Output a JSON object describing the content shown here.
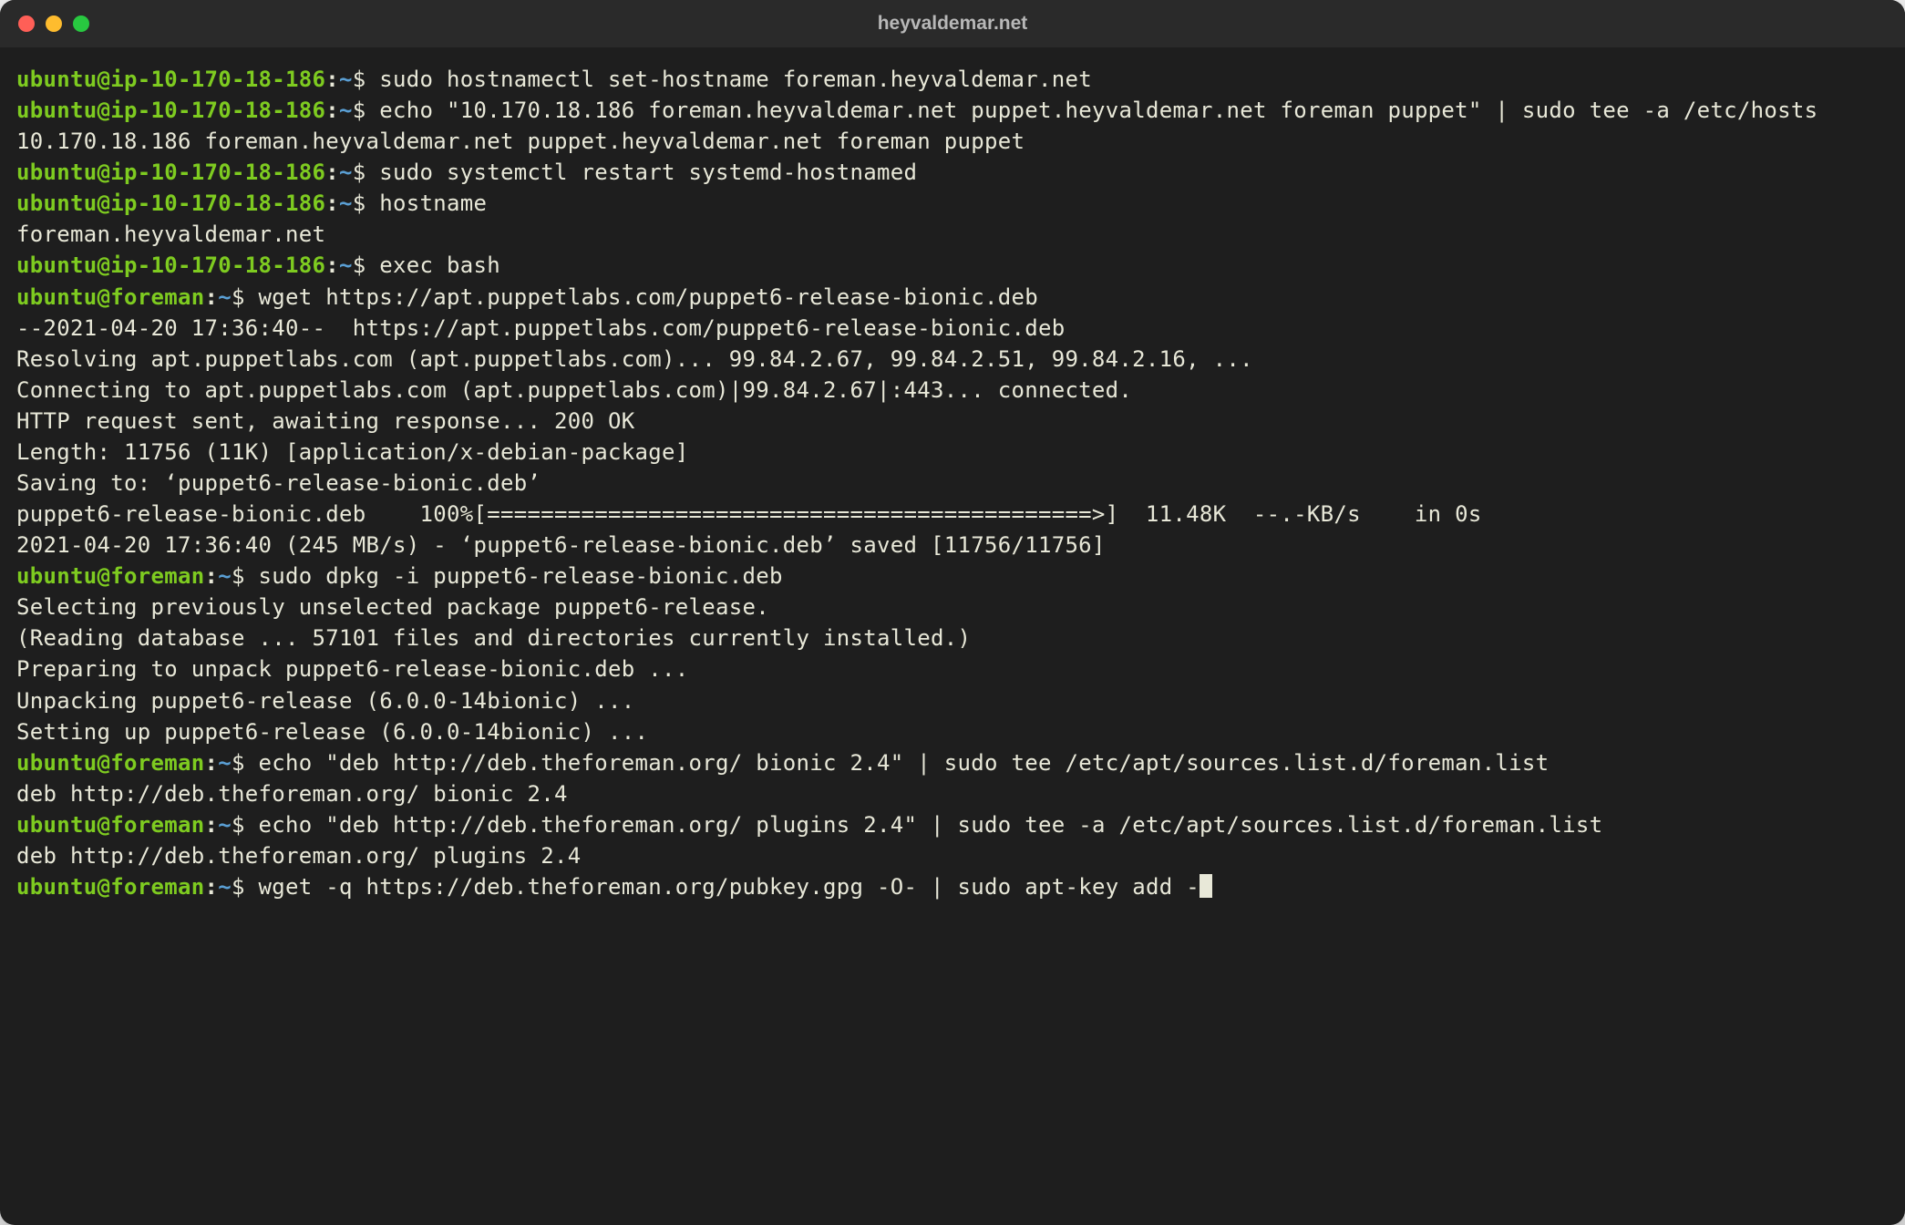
{
  "window": {
    "title": "heyvaldemar.net"
  },
  "colors": {
    "bg": "#1e1e1e",
    "titlebar": "#2a2a2a",
    "text": "#e8e8d8",
    "prompt_user": "#7ecb20",
    "prompt_path": "#5a9fd4",
    "traffic_red": "#ff5f57",
    "traffic_yellow": "#febc2e",
    "traffic_green": "#28c840"
  },
  "prompts": {
    "p1": {
      "user": "ubuntu",
      "host": "ip-10-170-18-186",
      "path": "~",
      "sym": "$"
    },
    "p2": {
      "user": "ubuntu",
      "host": "foreman",
      "path": "~",
      "sym": "$"
    }
  },
  "lines": {
    "l1_cmd": " sudo hostnamectl set-hostname foreman.heyvaldemar.net",
    "l2_cmd": " echo \"10.170.18.186 foreman.heyvaldemar.net puppet.heyvaldemar.net foreman puppet\" | sudo tee -a /etc/hosts",
    "l3_out": "10.170.18.186 foreman.heyvaldemar.net puppet.heyvaldemar.net foreman puppet",
    "l4_cmd": " sudo systemctl restart systemd-hostnamed",
    "l5_cmd": " hostname",
    "l6_out": "foreman.heyvaldemar.net",
    "l7_cmd": " exec bash",
    "l8_cmd": " wget https://apt.puppetlabs.com/puppet6-release-bionic.deb",
    "l9_out": "--2021-04-20 17:36:40--  https://apt.puppetlabs.com/puppet6-release-bionic.deb",
    "l10_out": "Resolving apt.puppetlabs.com (apt.puppetlabs.com)... 99.84.2.67, 99.84.2.51, 99.84.2.16, ...",
    "l11_out": "Connecting to apt.puppetlabs.com (apt.puppetlabs.com)|99.84.2.67|:443... connected.",
    "l12_out": "HTTP request sent, awaiting response... 200 OK",
    "l13_out": "Length: 11756 (11K) [application/x-debian-package]",
    "l14_out": "Saving to: ‘puppet6-release-bionic.deb’",
    "l15_blank": "",
    "l16_out": "puppet6-release-bionic.deb    100%[=============================================>]  11.48K  --.-KB/s    in 0s",
    "l17_blank": "",
    "l18_out": "2021-04-20 17:36:40 (245 MB/s) - ‘puppet6-release-bionic.deb’ saved [11756/11756]",
    "l19_blank": "",
    "l20_cmd": " sudo dpkg -i puppet6-release-bionic.deb",
    "l21_out": "Selecting previously unselected package puppet6-release.",
    "l22_out": "(Reading database ... 57101 files and directories currently installed.)",
    "l23_out": "Preparing to unpack puppet6-release-bionic.deb ...",
    "l24_out": "Unpacking puppet6-release (6.0.0-14bionic) ...",
    "l25_out": "Setting up puppet6-release (6.0.0-14bionic) ...",
    "l26_cmd": " echo \"deb http://deb.theforeman.org/ bionic 2.4\" | sudo tee /etc/apt/sources.list.d/foreman.list",
    "l27_out": "deb http://deb.theforeman.org/ bionic 2.4",
    "l28_cmd": " echo \"deb http://deb.theforeman.org/ plugins 2.4\" | sudo tee -a /etc/apt/sources.list.d/foreman.list",
    "l29_out": "deb http://deb.theforeman.org/ plugins 2.4",
    "l30_cmd": " wget -q https://deb.theforeman.org/pubkey.gpg -O- | sudo apt-key add -"
  }
}
